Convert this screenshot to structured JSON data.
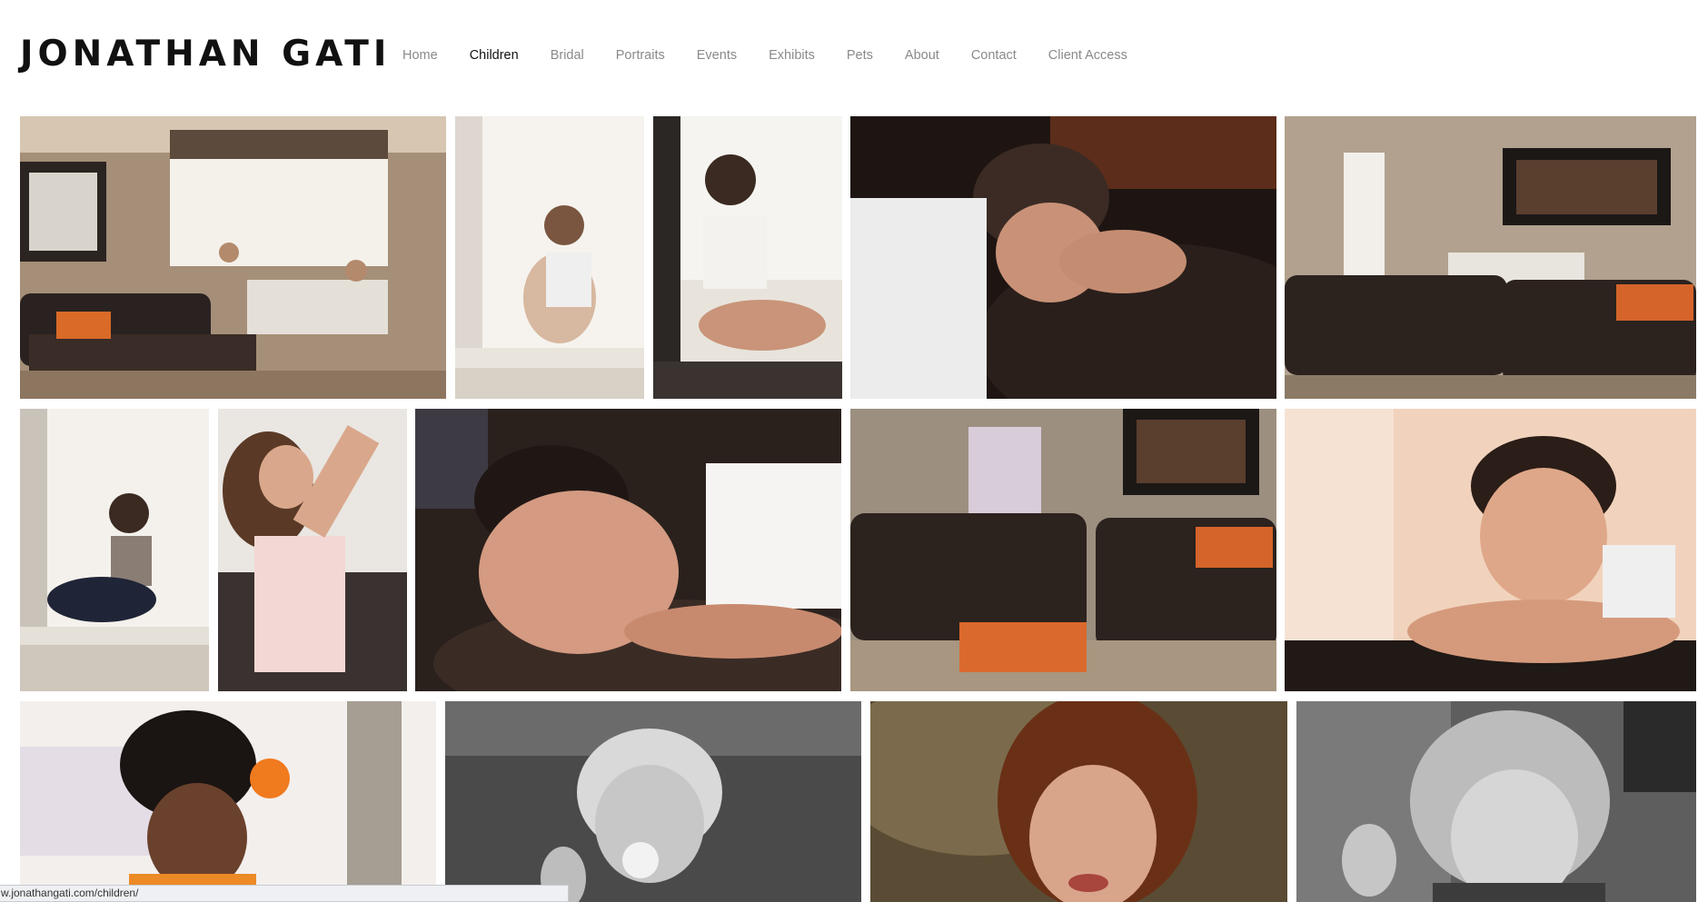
{
  "site": {
    "logo_text": "JONATHAN GATI"
  },
  "nav": {
    "items": [
      {
        "label": "Home",
        "active": false
      },
      {
        "label": "Children",
        "active": true
      },
      {
        "label": "Bridal",
        "active": false
      },
      {
        "label": "Portraits",
        "active": false
      },
      {
        "label": "Events",
        "active": false
      },
      {
        "label": "Exhibits",
        "active": false
      },
      {
        "label": "Pets",
        "active": false
      },
      {
        "label": "About",
        "active": false
      },
      {
        "label": "Contact",
        "active": false
      },
      {
        "label": "Client Access",
        "active": false
      }
    ]
  },
  "gallery": {
    "photos": [
      {
        "name": "living-room-children-photo",
        "icon": "living-room-scene"
      },
      {
        "name": "girl-window-sill-photo",
        "icon": "girl-sitting"
      },
      {
        "name": "boy-window-sill-photo",
        "icon": "boy-sitting"
      },
      {
        "name": "boy-lying-on-sofa-photo",
        "icon": "boy-lying"
      },
      {
        "name": "living-room-sofas-photo",
        "icon": "living-room-scene"
      },
      {
        "name": "girl-window-silhouette-photo",
        "icon": "girl-sitting"
      },
      {
        "name": "girl-drinking-photo",
        "icon": "girl-drinking"
      },
      {
        "name": "boy-closeup-on-sofa-photo",
        "icon": "boy-lying"
      },
      {
        "name": "children-on-sofas-photo",
        "icon": "living-room-scene"
      },
      {
        "name": "boy-arms-crossed-photo",
        "icon": "boy-portrait"
      },
      {
        "name": "girl-curly-hair-orange-flower-photo",
        "icon": "girl-portrait"
      },
      {
        "name": "toddler-pacifier-bw-photo",
        "icon": "toddler-portrait"
      },
      {
        "name": "curly-haired-girl-sepia-photo",
        "icon": "girl-portrait"
      },
      {
        "name": "girl-playing-hair-bw-photo",
        "icon": "girl-portrait"
      }
    ]
  },
  "status_bar": {
    "url": "w.jonathangati.com/children/"
  }
}
